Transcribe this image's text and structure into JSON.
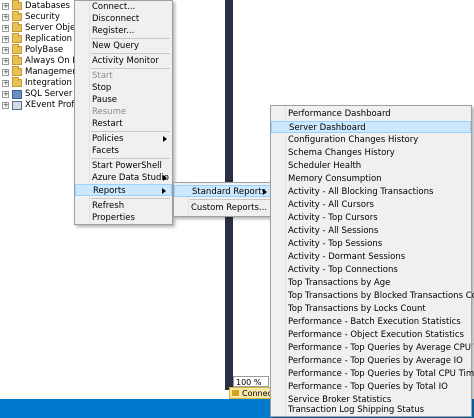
{
  "explorer": {
    "items": [
      {
        "label": "Databases",
        "icon": "folder-icon"
      },
      {
        "label": "Security",
        "icon": "folder-icon"
      },
      {
        "label": "Server Objec",
        "icon": "folder-icon"
      },
      {
        "label": "Replication",
        "icon": "folder-icon"
      },
      {
        "label": "PolyBase",
        "icon": "folder-icon"
      },
      {
        "label": "Always On H",
        "icon": "folder-icon"
      },
      {
        "label": "Managemen",
        "icon": "folder-icon"
      },
      {
        "label": "Integration S",
        "icon": "folder-icon"
      },
      {
        "label": "SQL Server A",
        "icon": "agent-icon"
      },
      {
        "label": "XEvent Profil",
        "icon": "xevent-icon"
      }
    ]
  },
  "context_menu": {
    "items": [
      "Connect...",
      "Disconnect",
      "Register...",
      "New Query",
      "Activity Monitor",
      "Start",
      "Stop",
      "Pause",
      "Resume",
      "Restart",
      "Policies",
      "Facets",
      "Start PowerShell",
      "Azure Data Studio",
      "Reports",
      "Refresh",
      "Properties"
    ]
  },
  "reports_menu": {
    "standard": "Standard Reports",
    "custom": "Custom Reports..."
  },
  "standard_reports": {
    "items": [
      "Performance Dashboard",
      "Server Dashboard",
      "Configuration Changes History",
      "Schema Changes History",
      "Scheduler Health",
      "Memory Consumption",
      "Activity - All Blocking Transactions",
      "Activity - All Cursors",
      "Activity - Top Cursors",
      "Activity - All Sessions",
      "Activity - Top Sessions",
      "Activity - Dormant Sessions",
      "Activity - Top Connections",
      "Top Transactions by Age",
      "Top Transactions by Blocked Transactions Count",
      "Top Transactions by Locks Count",
      "Performance - Batch Execution Statistics",
      "Performance - Object Execution Statistics",
      "Performance - Top Queries by Average CPU Time",
      "Performance - Top Queries by Average IO",
      "Performance - Top Queries by Total CPU Time",
      "Performance - Top Queries by Total IO",
      "Service Broker Statistics",
      "Transaction Log Shipping Status"
    ]
  },
  "status": {
    "zoom": "100 %",
    "connected": "Connect"
  },
  "colors": {
    "highlight": "#cce8ff",
    "statusbar": "#007acc",
    "dark_strip": "#2b2f45"
  }
}
